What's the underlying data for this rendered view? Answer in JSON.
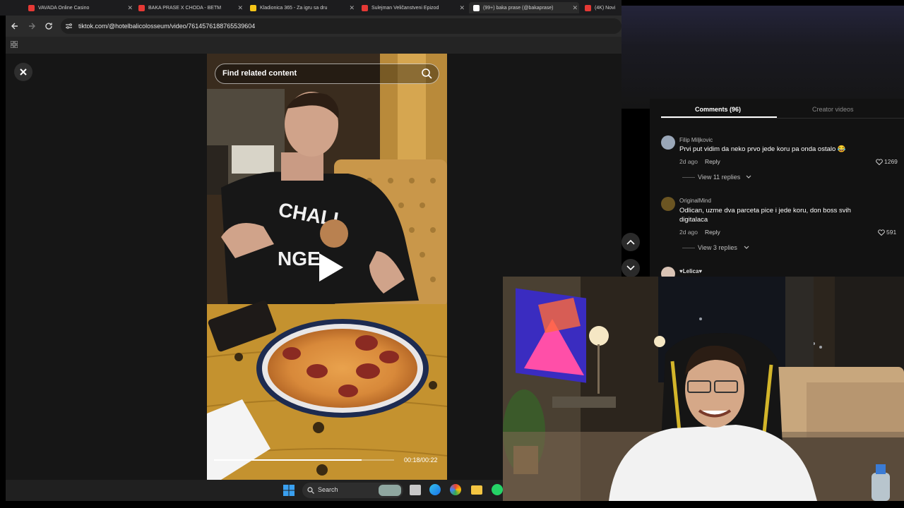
{
  "browser": {
    "tabs": [
      {
        "label": "VAVADA Online Casino",
        "color": "#e53935"
      },
      {
        "label": "BAKA PRASE X CHODA - BETM",
        "color": "#e53935"
      },
      {
        "label": "Kladionica 365 - Za igru sa dru",
        "color": "#f5c518"
      },
      {
        "label": "Sulejman Veličanstveni Epizod",
        "color": "#e53935"
      },
      {
        "label": "(99+) baka prase (@bakaprase)",
        "color": "#ffffff"
      },
      {
        "label": "(4K) Novi",
        "color": "#e53935"
      }
    ],
    "url": "tiktok.com/@hotelbalicolosseum/video/7614576188765539604"
  },
  "video": {
    "search_placeholder": "Find related content",
    "timecode": "00:18/00:22",
    "progress": 0.82
  },
  "comments": {
    "tab_comments": "Comments (96)",
    "tab_creator": "Creator videos",
    "items": [
      {
        "username": "Filip Miljkovic",
        "text": "Prvi put vidim da neko prvo jede koru pa onda ostalo 😂",
        "time": "2d ago",
        "reply": "Reply",
        "likes": "1269",
        "view_replies": "View 11 replies"
      },
      {
        "username": "OriginalMind",
        "text": "Odlican, uzme dva parceta pice i jede koru, don boss svih digitalaca",
        "time": "2d ago",
        "reply": "Reply",
        "likes": "591",
        "view_replies": "View 3 replies"
      },
      {
        "username": "♥Lelica♥"
      }
    ]
  },
  "taskbar": {
    "search_label": "Search"
  },
  "colors": {
    "accent_underline": "#ffffff",
    "shirt_white": "#f2f2f2"
  }
}
